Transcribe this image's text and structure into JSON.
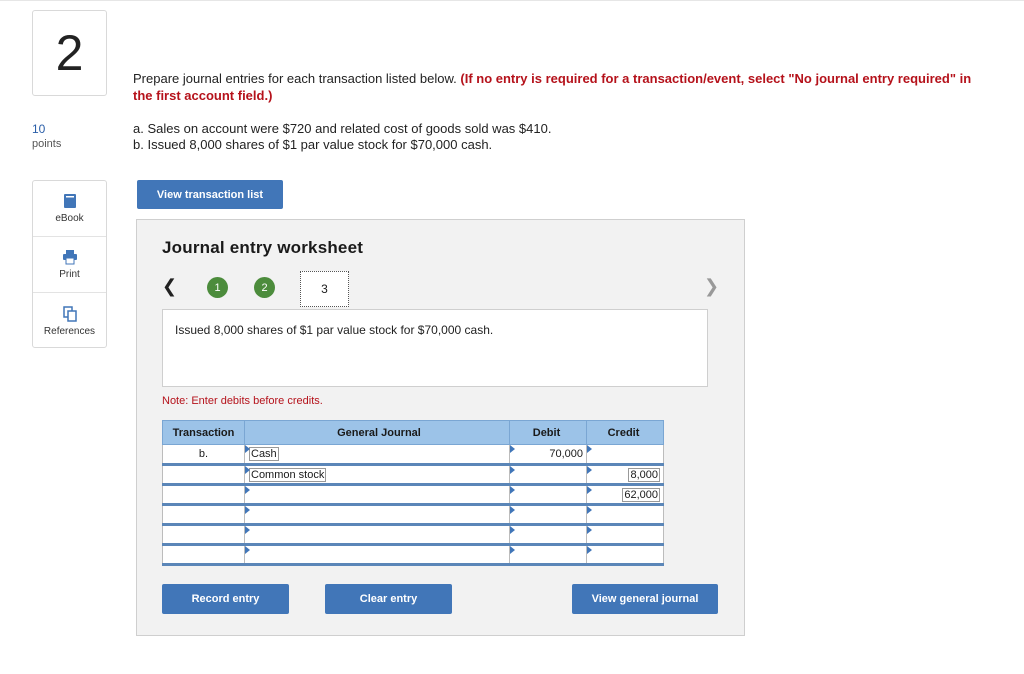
{
  "question": {
    "number": "2",
    "points_value": "10",
    "points_label": "points"
  },
  "tools": [
    {
      "label": "eBook",
      "icon": "book-icon"
    },
    {
      "label": "Print",
      "icon": "printer-icon"
    },
    {
      "label": "References",
      "icon": "copy-icon"
    }
  ],
  "prompt": {
    "text": "Prepare journal entries for each transaction listed below.",
    "emphasis": "(If no entry is required for a transaction/event, select \"No journal entry required\" in the first account field.)"
  },
  "transactions": [
    "a. Sales on account were $720 and related cost of goods sold was $410.",
    "b. Issued 8,000 shares of $1 par value stock for $70,000 cash."
  ],
  "view_transaction_list_label": "View transaction list",
  "worksheet": {
    "title": "Journal entry worksheet",
    "steps": [
      "1",
      "2",
      "3"
    ],
    "current_step": "3",
    "description": "Issued 8,000 shares of $1 par value stock for $70,000 cash.",
    "note": "Note: Enter debits before credits.",
    "columns": [
      "Transaction",
      "General Journal",
      "Debit",
      "Credit"
    ],
    "rows": [
      {
        "transaction": "b.",
        "account": "Cash",
        "debit": "70,000",
        "credit": ""
      },
      {
        "transaction": "",
        "account": "Common stock",
        "debit": "",
        "credit": "8,000"
      },
      {
        "transaction": "",
        "account": "",
        "debit": "",
        "credit": "62,000"
      },
      {
        "transaction": "",
        "account": "",
        "debit": "",
        "credit": ""
      },
      {
        "transaction": "",
        "account": "",
        "debit": "",
        "credit": ""
      },
      {
        "transaction": "",
        "account": "",
        "debit": "",
        "credit": ""
      }
    ],
    "buttons": {
      "record": "Record entry",
      "clear": "Clear entry",
      "view_general_journal": "View general journal"
    }
  },
  "colors": {
    "button_blue": "#4176b8",
    "header_blue": "#9cc3e8",
    "step_green": "#4c8c3c",
    "emphasis_red": "#b5121b"
  }
}
